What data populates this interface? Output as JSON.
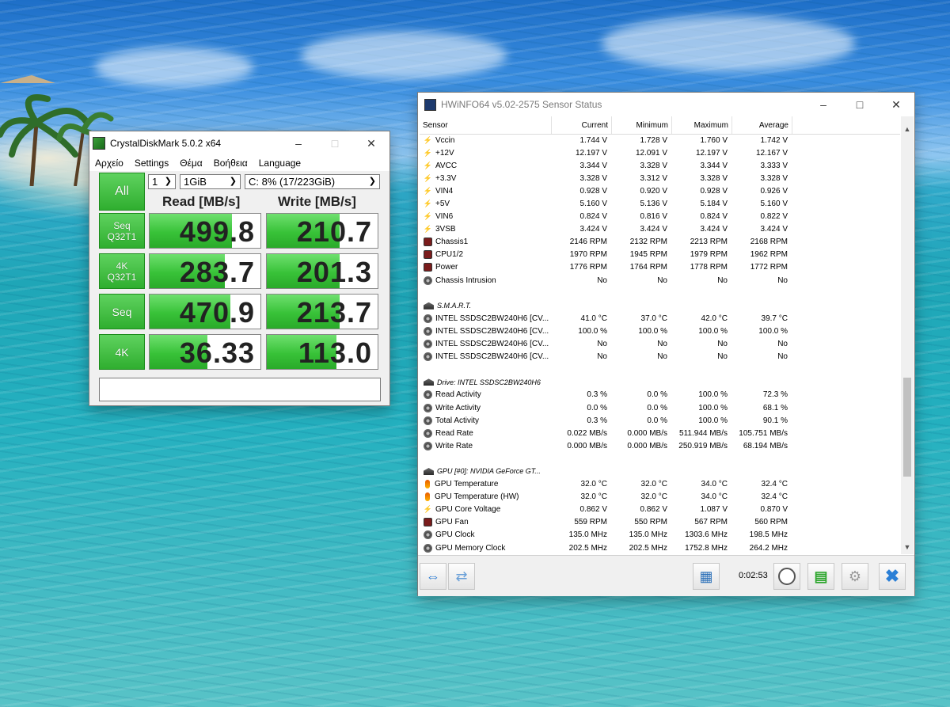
{
  "crystaldiskmark": {
    "title": "CrystalDiskMark 5.0.2 x64",
    "menu": [
      "Αρχείο",
      "Settings",
      "Θέμα",
      "Βοήθεια",
      "Language"
    ],
    "all_button": "All",
    "count_select": "1",
    "size_select": "1GiB",
    "drive_select": "C: 8% (17/223GiB)",
    "read_header": "Read [MB/s]",
    "write_header": "Write [MB/s]",
    "tests": [
      {
        "label_line1": "Seq",
        "label_line2": "Q32T1",
        "read": "499.8",
        "write": "210.7"
      },
      {
        "label_line1": "4K",
        "label_line2": "Q32T1",
        "read": "283.7",
        "write": "201.3"
      },
      {
        "label_line1": "Seq",
        "label_line2": "",
        "read": "470.9",
        "write": "213.7"
      },
      {
        "label_line1": "4K",
        "label_line2": "",
        "read": "36.33",
        "write": "113.0"
      }
    ],
    "status_text": ""
  },
  "hwinfo": {
    "title": "HWiNFO64 v5.02-2575 Sensor Status",
    "columns": [
      "Sensor",
      "Current",
      "Minimum",
      "Maximum",
      "Average"
    ],
    "rows": [
      {
        "icon": "volt",
        "name": "Vccin",
        "cur": "1.744 V",
        "min": "1.728 V",
        "max": "1.760 V",
        "avg": "1.742 V"
      },
      {
        "icon": "volt",
        "name": "+12V",
        "cur": "12.197 V",
        "min": "12.091 V",
        "max": "12.197 V",
        "avg": "12.167 V"
      },
      {
        "icon": "volt",
        "name": "AVCC",
        "cur": "3.344 V",
        "min": "3.328 V",
        "max": "3.344 V",
        "avg": "3.333 V"
      },
      {
        "icon": "volt",
        "name": "+3.3V",
        "cur": "3.328 V",
        "min": "3.312 V",
        "max": "3.328 V",
        "avg": "3.328 V"
      },
      {
        "icon": "volt",
        "name": "VIN4",
        "cur": "0.928 V",
        "min": "0.920 V",
        "max": "0.928 V",
        "avg": "0.926 V"
      },
      {
        "icon": "volt",
        "name": "+5V",
        "cur": "5.160 V",
        "min": "5.136 V",
        "max": "5.184 V",
        "avg": "5.160 V"
      },
      {
        "icon": "volt",
        "name": "VIN6",
        "cur": "0.824 V",
        "min": "0.816 V",
        "max": "0.824 V",
        "avg": "0.822 V"
      },
      {
        "icon": "volt",
        "name": "3VSB",
        "cur": "3.424 V",
        "min": "3.424 V",
        "max": "3.424 V",
        "avg": "3.424 V"
      },
      {
        "icon": "fan",
        "name": "Chassis1",
        "cur": "2146 RPM",
        "min": "2132 RPM",
        "max": "2213 RPM",
        "avg": "2168 RPM"
      },
      {
        "icon": "fan",
        "name": "CPU1/2",
        "cur": "1970 RPM",
        "min": "1945 RPM",
        "max": "1979 RPM",
        "avg": "1962 RPM"
      },
      {
        "icon": "fan",
        "name": "Power",
        "cur": "1776 RPM",
        "min": "1764 RPM",
        "max": "1778 RPM",
        "avg": "1772 RPM"
      },
      {
        "icon": "gear",
        "name": "Chassis Intrusion",
        "cur": "No",
        "min": "No",
        "max": "No",
        "avg": "No"
      },
      {
        "icon": "blank",
        "name": "",
        "cur": "",
        "min": "",
        "max": "",
        "avg": ""
      },
      {
        "icon": "group",
        "group": true,
        "name": "S.M.A.R.T.",
        "cur": "",
        "min": "",
        "max": "",
        "avg": ""
      },
      {
        "icon": "gear",
        "name": "INTEL SSDSC2BW240H6 [CV...",
        "cur": "41.0 °C",
        "min": "37.0 °C",
        "max": "42.0 °C",
        "avg": "39.7 °C"
      },
      {
        "icon": "gear",
        "name": "INTEL SSDSC2BW240H6 [CV...",
        "cur": "100.0 %",
        "min": "100.0 %",
        "max": "100.0 %",
        "avg": "100.0 %"
      },
      {
        "icon": "gear",
        "name": "INTEL SSDSC2BW240H6 [CV...",
        "cur": "No",
        "min": "No",
        "max": "No",
        "avg": "No"
      },
      {
        "icon": "gear",
        "name": "INTEL SSDSC2BW240H6 [CV...",
        "cur": "No",
        "min": "No",
        "max": "No",
        "avg": "No"
      },
      {
        "icon": "blank",
        "name": "",
        "cur": "",
        "min": "",
        "max": "",
        "avg": ""
      },
      {
        "icon": "group",
        "group": true,
        "name": "Drive: INTEL SSDSC2BW240H6",
        "cur": "",
        "min": "",
        "max": "",
        "avg": ""
      },
      {
        "icon": "gear",
        "name": "Read Activity",
        "cur": "0.3 %",
        "min": "0.0 %",
        "max": "100.0 %",
        "avg": "72.3 %"
      },
      {
        "icon": "gear",
        "name": "Write Activity",
        "cur": "0.0 %",
        "min": "0.0 %",
        "max": "100.0 %",
        "avg": "68.1 %"
      },
      {
        "icon": "gear",
        "name": "Total Activity",
        "cur": "0.3 %",
        "min": "0.0 %",
        "max": "100.0 %",
        "avg": "90.1 %"
      },
      {
        "icon": "gear",
        "name": "Read Rate",
        "cur": "0.022 MB/s",
        "min": "0.000 MB/s",
        "max": "511.944 MB/s",
        "avg": "105.751 MB/s"
      },
      {
        "icon": "gear",
        "name": "Write Rate",
        "cur": "0.000 MB/s",
        "min": "0.000 MB/s",
        "max": "250.919 MB/s",
        "avg": "68.194 MB/s"
      },
      {
        "icon": "blank",
        "name": "",
        "cur": "",
        "min": "",
        "max": "",
        "avg": ""
      },
      {
        "icon": "group",
        "group": true,
        "name": "GPU [#0]: NVIDIA GeForce GT...",
        "cur": "",
        "min": "",
        "max": "",
        "avg": ""
      },
      {
        "icon": "therm",
        "name": "GPU Temperature",
        "cur": "32.0 °C",
        "min": "32.0 °C",
        "max": "34.0 °C",
        "avg": "32.4 °C"
      },
      {
        "icon": "therm",
        "name": "GPU Temperature (HW)",
        "cur": "32.0 °C",
        "min": "32.0 °C",
        "max": "34.0 °C",
        "avg": "32.4 °C"
      },
      {
        "icon": "volt",
        "name": "GPU Core Voltage",
        "cur": "0.862 V",
        "min": "0.862 V",
        "max": "1.087 V",
        "avg": "0.870 V"
      },
      {
        "icon": "fan",
        "name": "GPU Fan",
        "cur": "559 RPM",
        "min": "550 RPM",
        "max": "567 RPM",
        "avg": "560 RPM"
      },
      {
        "icon": "gear",
        "name": "GPU Clock",
        "cur": "135.0 MHz",
        "min": "135.0 MHz",
        "max": "1303.6 MHz",
        "avg": "198.5 MHz"
      },
      {
        "icon": "gear",
        "name": "GPU Memory Clock",
        "cur": "202.5 MHz",
        "min": "202.5 MHz",
        "max": "1752.8 MHz",
        "avg": "264.2 MHz"
      }
    ],
    "timer": "0:02:53"
  }
}
